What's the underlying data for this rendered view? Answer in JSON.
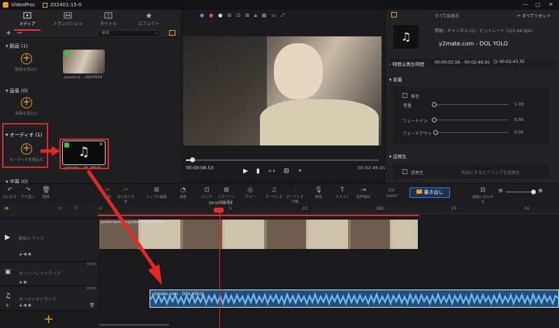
{
  "app": {
    "name": "VideoProc",
    "project": "202401-15-0"
  },
  "media_tabs": [
    {
      "label": "メディア"
    },
    {
      "label": "トランジション"
    },
    {
      "label": "タイトル"
    },
    {
      "label": "エフェクト"
    }
  ],
  "search": {
    "placeholder": "検索..."
  },
  "sections": {
    "video": {
      "title": "動画 (1)",
      "add_label": "動画を読込む",
      "clip_name": "pexels-k...-8909958"
    },
    "image": {
      "title": "画像 (0)",
      "add_label": "画像を読込む"
    },
    "audio": {
      "title": "オーディオ (1)",
      "add_label": "オーディオを読込む",
      "clip_name": "y2mate....OL YOLO"
    },
    "subtitle": {
      "title": "字幕 (0)"
    }
  },
  "player": {
    "current": "00:00:08.53",
    "total": "00:02:46.91"
  },
  "info": {
    "show_all": "すべて目表示",
    "reset_all": "すべてリセット",
    "meta": "情報：チャンネル (2)、ビットレート (125.6K bps)",
    "clip_title": "y2mate.com - DOL YOLO",
    "time_section": "時間＆再生時間",
    "time_range": "00:00:03.56 - 00:02:46.91",
    "duration": "00:02:43.35",
    "volume_section": "音量",
    "mute": "無音",
    "volume_label": "音量",
    "volume_value": "1.00",
    "fadein_label": "フェードイン",
    "fadein_value": "0.00",
    "fadeout_label": "フェードアウト",
    "fadeout_value": "0.00",
    "reverse_section": "逆再生",
    "reverse_label": "逆再生",
    "reverse_hint": "有効にするとクリップを逆再生"
  },
  "toolbar": {
    "tools": [
      "分割",
      "まとめて分割",
      "リップル編集",
      "速度",
      "ロック",
      "スクリーン切り替え",
      "カラー",
      "オーディオ",
      "オーディオ分離",
      "録音",
      "テキスト",
      "音声抽出",
      "1080P"
    ],
    "undo": "元に戻す",
    "redo": "やり直し",
    "delete": "削除",
    "export": "書き出し",
    "fit": "画面に合わせる"
  },
  "timeline": {
    "ruler": [
      "0",
      "00:00:08.53",
      "5",
      "10",
      "15",
      "20",
      "25",
      "30"
    ],
    "tracks": {
      "video": "動画トラック",
      "overlay": "オーバーレイトラック",
      "audio": "オーディオトラック"
    },
    "video_clip": "pexels-karolina-grabowska-8909958",
    "audio_clip": "y2mate.com - DOL YOLO",
    "zoom100": "100%"
  }
}
